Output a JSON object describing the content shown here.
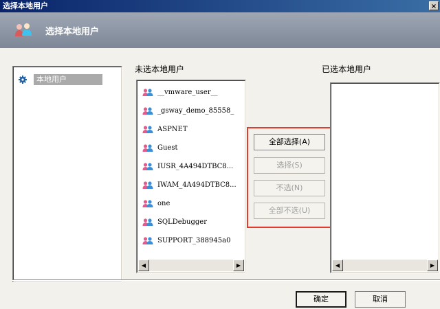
{
  "window": {
    "title": "选择本地用户",
    "close_glyph": "×"
  },
  "header": {
    "title": "选择本地用户",
    "icon": "users-icon"
  },
  "tree": {
    "item_label": "本地用户",
    "item_icon": "gear-icon"
  },
  "available": {
    "label": "未选本地用户",
    "users": [
      "__vmware_user__",
      "_gsway_demo_85558_",
      "ASPNET",
      "Guest",
      "IUSR_4A494DTBC8...",
      "IWAM_4A494DTBC8...",
      "one",
      "SQLDebugger",
      "SUPPORT_388945a0"
    ]
  },
  "selected": {
    "label": "已选本地用户",
    "users": []
  },
  "actions": {
    "select_all": "全部选择(A)",
    "select": "选择(S)",
    "unselect": "不选(N)",
    "unselect_all": "全部不选(U)"
  },
  "footer": {
    "ok": "确定",
    "cancel": "取消"
  },
  "colors": {
    "highlight_border": "#e53a2d",
    "user_icon": "#3b8fd6"
  }
}
